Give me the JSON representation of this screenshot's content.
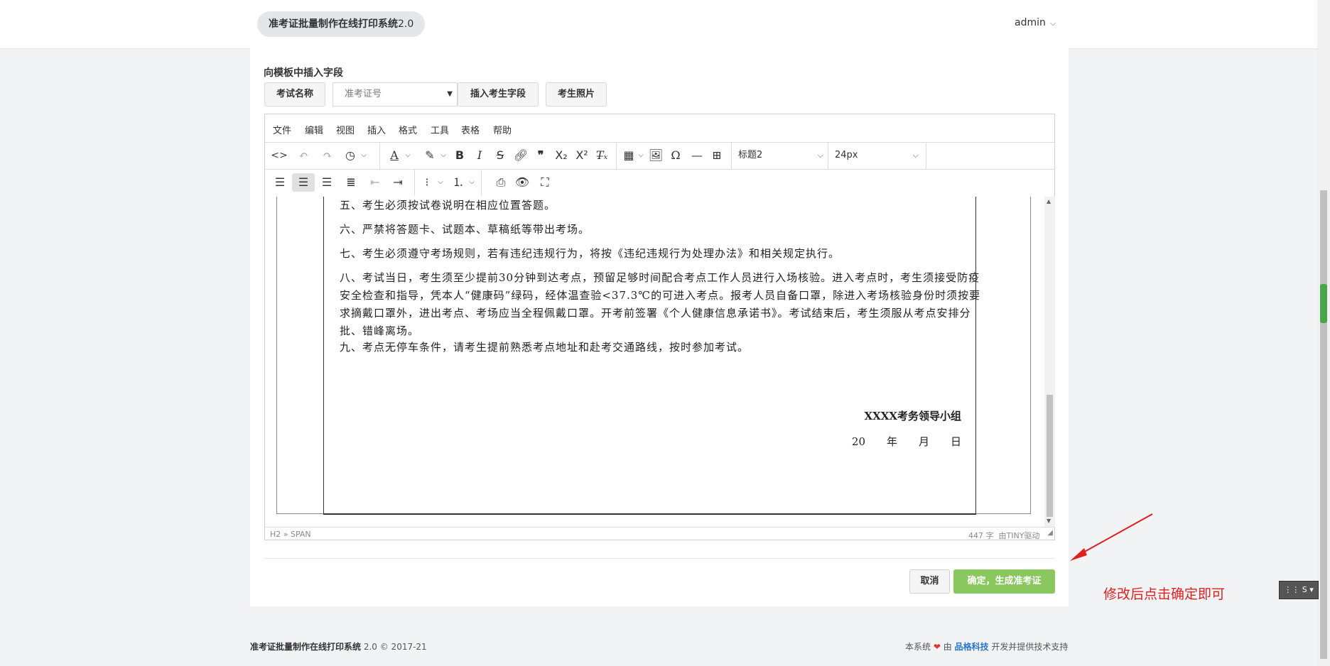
{
  "header": {
    "brand_title": "准考证批量制作在线打印系统",
    "brand_version": "2.0",
    "user_name": "admin"
  },
  "insert_fields": {
    "section_label": "向模板中插入字段",
    "exam_name_button": "考试名称",
    "field_select_value": "准考证号",
    "insert_student_field_button": "插入考生字段",
    "student_photo_button": "考生照片"
  },
  "editor": {
    "menu": [
      "文件",
      "编辑",
      "视图",
      "插入",
      "格式",
      "工具",
      "表格",
      "帮助"
    ],
    "block_format": "标题2",
    "font_size": "24px",
    "paragraphs": [
      "五、考生必须按试卷说明在相应位置答题。",
      "六、严禁将答题卡、试题本、草稿纸等带出考场。",
      "七、考生必须遵守考场规则，若有违纪违规行为，将按《违纪违规行为处理办法》和相关规定执行。",
      "八、考试当日，考生须至少提前30分钟到达考点，预留足够时间配合考点工作人员进行入场核验。进入考点时，考生须接受防疫安全检查和指导，凭本人“健康码”绿码，经体温查验<37.3℃的可进入考点。报考人员自备口罩，除进入考场核验身份时须按要求摘戴口罩外，进出考点、考场应当全程佩戴口罩。开考前签署《个人健康信息承诺书》。考试结束后，考生须服从考点安排分批、错峰离场。",
      "九、考点无停车条件，请考生提前熟悉考点地址和赴考交通路线，按时参加考试。"
    ],
    "signature": "XXXX考务领导小组",
    "date_line": "20　　年　　月　　日",
    "status_path": "H2 » SPAN",
    "status_count": "447 字",
    "status_powered": "由TINY驱动"
  },
  "actions": {
    "cancel_button": "取消",
    "confirm_button": "确定，生成准考证"
  },
  "annotation": {
    "text": "修改后点击确定即可",
    "color": "#e02020"
  },
  "footer": {
    "left_title": "准考证批量制作在线打印系统",
    "left_version": "2.0 © 2017-21",
    "right_prefix": "本系统",
    "right_by": "由",
    "right_company": "品格科技",
    "right_suffix": "开发并提供技术支持"
  },
  "colors": {
    "confirm_green": "#8ac75f",
    "link_blue": "#2a77c9",
    "heart_red": "#e0342f"
  }
}
